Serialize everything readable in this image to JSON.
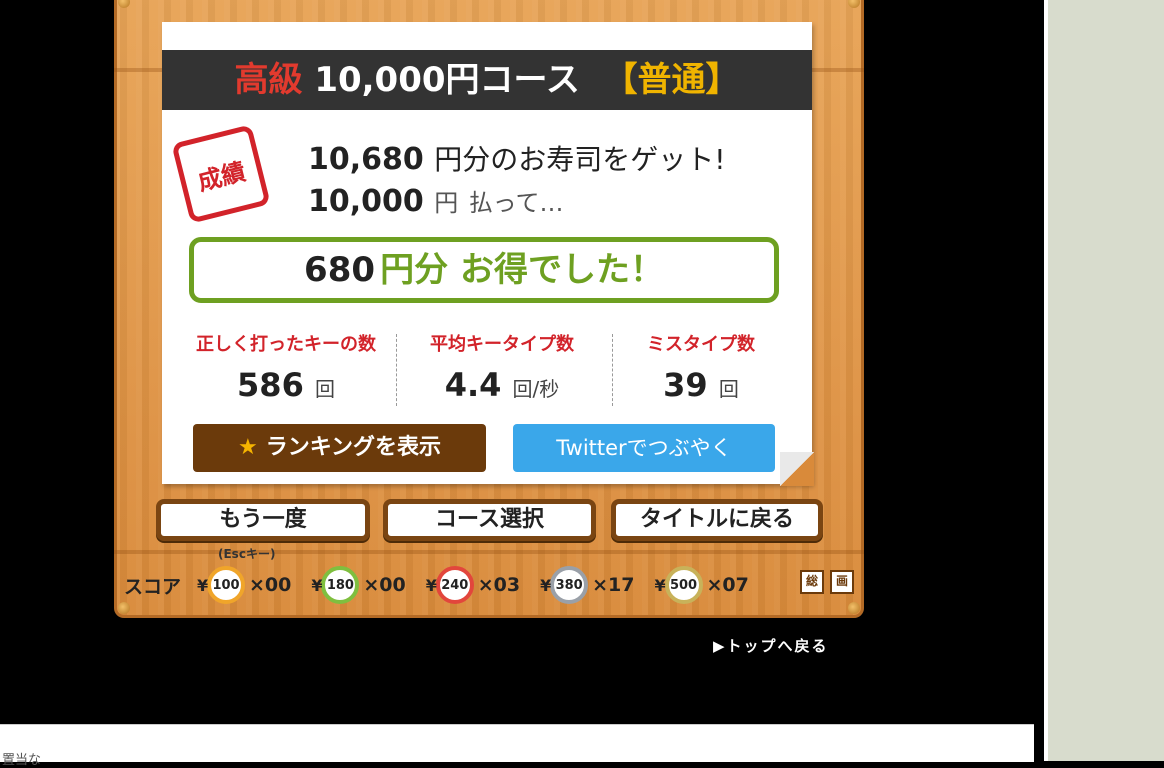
{
  "course": {
    "prefix": "高級",
    "name": "10,000円コース",
    "difficulty": "【普通】"
  },
  "result": {
    "seal": "成績",
    "got_amount": "10,680",
    "got_text": "円分のお寿司をゲット!",
    "paid_amount": "10,000",
    "paid_unit": "円",
    "paid_text": "払って…",
    "profit_amount": "680",
    "profit_text": "円分 お得でした！"
  },
  "stats": [
    {
      "label": "正しく打ったキーの数",
      "value": "586",
      "unit": "回"
    },
    {
      "label": "平均キータイプ数",
      "value": "4.4",
      "unit": "回/秒"
    },
    {
      "label": "ミスタイプ数",
      "value": "39",
      "unit": "回"
    }
  ],
  "buttons": {
    "ranking": "ランキングを表示",
    "twitter": "Twitterでつぶやく",
    "retry": "もう一度",
    "retry_hint": "(Escキー)",
    "course_select": "コース選択",
    "back_title": "タイトルに戻る"
  },
  "score": {
    "label": "スコア",
    "plates": [
      {
        "price": "100",
        "count": "×00",
        "color": "#f0a52a"
      },
      {
        "price": "180",
        "count": "×00",
        "color": "#7fbf3f"
      },
      {
        "price": "240",
        "count": "×03",
        "color": "#e2463c"
      },
      {
        "price": "380",
        "count": "×17",
        "color": "#9aa0a8"
      },
      {
        "price": "500",
        "count": "×07",
        "color": "#c8b25a"
      }
    ],
    "icon1": "総",
    "icon2": "画"
  },
  "back_top": "▶トップへ戻る",
  "footer_text": "置当な"
}
